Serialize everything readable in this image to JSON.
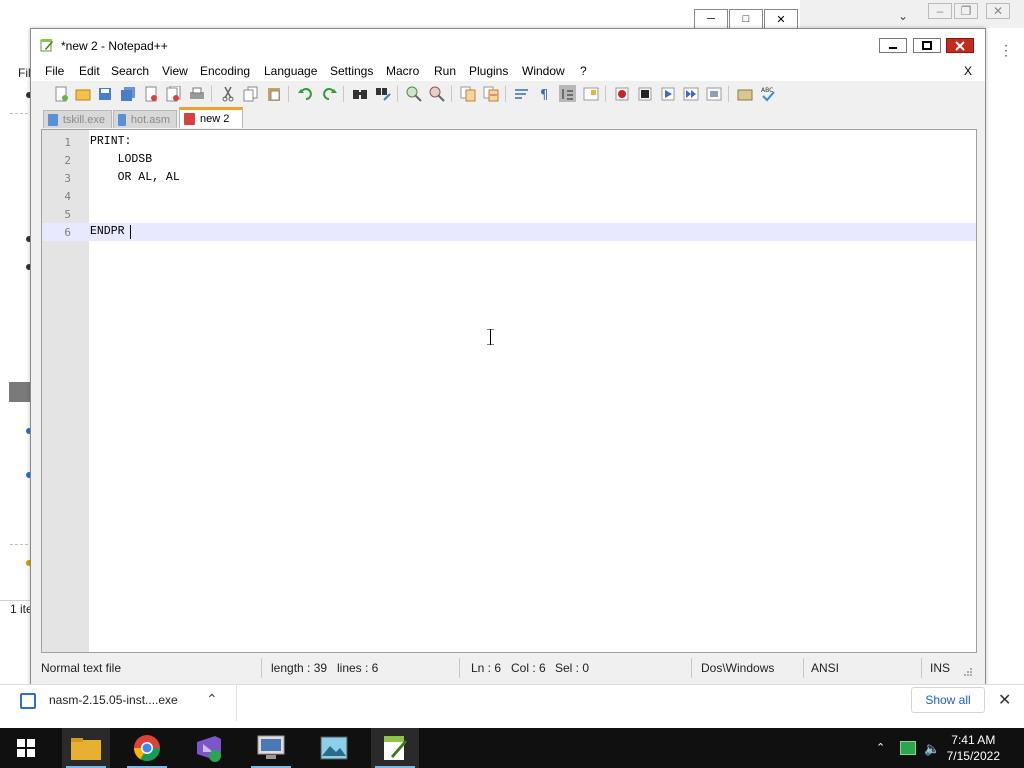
{
  "background": {
    "left_window": {
      "menu_fragment": "Fil",
      "status_fragment": "1 ite"
    }
  },
  "window": {
    "title": "*new  2 - Notepad++",
    "menu": [
      "File",
      "Edit",
      "Search",
      "View",
      "Encoding",
      "Language",
      "Settings",
      "Macro",
      "Run",
      "Plugins",
      "Window",
      "?"
    ],
    "menu_close": "X"
  },
  "toolbar": {
    "icons": [
      "new-file-icon",
      "open-file-icon",
      "save-icon",
      "save-all-icon",
      "close-icon",
      "close-all-icon",
      "print-icon",
      "cut-icon",
      "copy-icon",
      "paste-icon",
      "undo-icon",
      "redo-icon",
      "find-icon",
      "replace-icon",
      "zoom-in-icon",
      "zoom-out-icon",
      "sync-vertical-icon",
      "sync-horizontal-icon",
      "word-wrap-icon",
      "show-all-chars-icon",
      "indent-guide-icon",
      "document-map-icon",
      "record-macro-icon",
      "stop-record-icon",
      "play-macro-icon",
      "run-macro-multiple-icon",
      "save-macro-icon",
      "folder-as-workspace-icon",
      "spell-check-icon"
    ]
  },
  "tabs": [
    {
      "label": "tskill.exe",
      "color": "#5b8fd6",
      "active": false
    },
    {
      "label": "hot.asm",
      "color": "#5b8fd6",
      "active": false
    },
    {
      "label": "new  2",
      "color": "#d94040",
      "active": true
    }
  ],
  "editor": {
    "lines": [
      {
        "num": "1",
        "text": "PRINT:"
      },
      {
        "num": "2",
        "text": "    LODSB"
      },
      {
        "num": "3",
        "text": "    OR AL, AL"
      },
      {
        "num": "4",
        "text": ""
      },
      {
        "num": "5",
        "text": ""
      },
      {
        "num": "6",
        "text": "ENDPR"
      }
    ],
    "current_line": 6,
    "current_line_color": "#e8e8ff"
  },
  "status": {
    "file_type": "Normal text file",
    "length": "length : 39",
    "lines": "lines : 6",
    "ln": "Ln : 6",
    "col": "Col : 6",
    "sel": "Sel : 0",
    "eol": "Dos\\Windows",
    "encoding": "ANSI",
    "mode": "INS"
  },
  "download": {
    "filename": "nasm-2.15.05-inst....exe",
    "show_all": "Show all"
  },
  "taskbar": {
    "time": "7:41 AM",
    "date": "7/15/2022",
    "apps": [
      "windows-start-icon",
      "file-explorer-icon",
      "chrome-icon",
      "visual-studio-icon",
      "remote-desktop-icon",
      "image-viewer-icon",
      "notepad-plus-plus-icon"
    ]
  }
}
